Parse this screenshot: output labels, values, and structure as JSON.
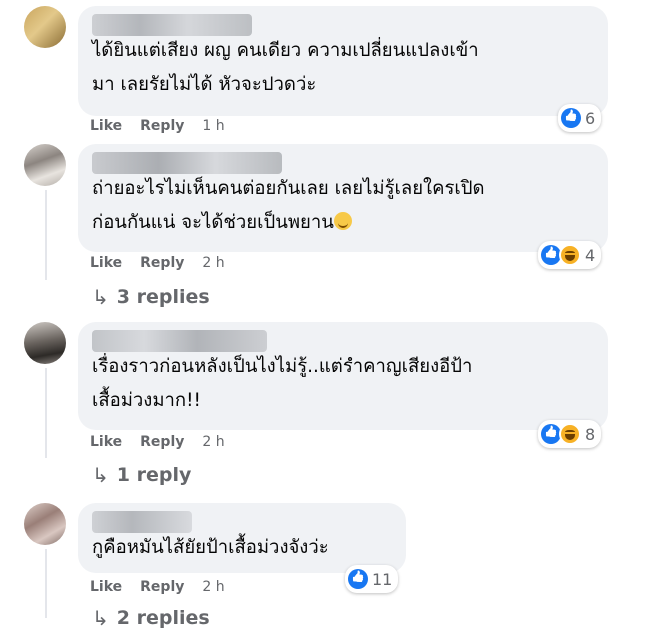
{
  "comments": [
    {
      "text": "ได้ยินแต่เสียง ผญ คนเดียว ความเปลี่ยนแปลงเข้า\nมา เลยรัยไม่ได้ หัวจะปวดว่ะ",
      "like_label": "Like",
      "reply_label": "Reply",
      "time": "1 h",
      "reaction_count": "6",
      "reaction_icons": [
        "like-icon"
      ]
    },
    {
      "text": "ถ่ายอะไรไม่เห็นคนต่อยกันเลย เลยไม่รู้เลยใครเปิด\nก่อนกันแน่ จะได้ช่วยเป็นพยาน",
      "like_label": "Like",
      "reply_label": "Reply",
      "time": "2 h",
      "reaction_count": "4",
      "reaction_icons": [
        "like-icon",
        "haha-icon"
      ],
      "replies_label": "3 replies"
    },
    {
      "text": "เรื่องราวก่อนหลังเป็นไงไม่รู้..แต่รำคาญเสียงอีป้า\nเสื้อม่วงมาก!!",
      "like_label": "Like",
      "reply_label": "Reply",
      "time": "2 h",
      "reaction_count": "8",
      "reaction_icons": [
        "like-icon",
        "haha-icon"
      ],
      "replies_label": "1 reply"
    },
    {
      "text": "กูคือหมันไส้ยัยป้าเสื้อม่วงจังว่ะ",
      "like_label": "Like",
      "reply_label": "Reply",
      "time": "2 h",
      "reaction_count": "11",
      "reaction_icons": [
        "like-icon"
      ],
      "replies_label": "2 replies"
    }
  ],
  "colors": {
    "bubble": "#f0f2f5",
    "meta_text": "#65676b",
    "like_blue": "#1877f2",
    "haha_yellow": "#f7b125"
  }
}
